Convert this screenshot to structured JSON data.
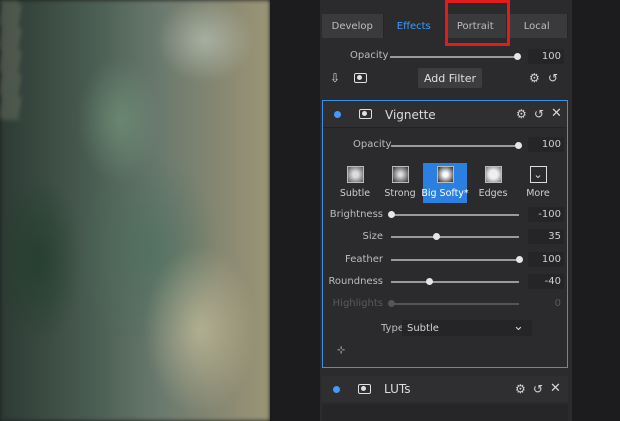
{
  "tabs": [
    {
      "label": "Develop",
      "active": false
    },
    {
      "label": "Effects",
      "active": true
    },
    {
      "label": "Portrait",
      "active": false
    },
    {
      "label": "Local",
      "active": false
    }
  ],
  "global": {
    "opacity_label": "Opacity",
    "opacity_value": "100",
    "opacity_fraction": 1.0,
    "add_filter_label": "Add Filter"
  },
  "vignette": {
    "title": "Vignette",
    "opacity_label": "Opacity",
    "opacity_value": "100",
    "opacity_fraction": 1.0,
    "presets": [
      {
        "label": "Subtle",
        "selected": false
      },
      {
        "label": "Strong",
        "selected": false
      },
      {
        "label": "Big Softy*",
        "selected": true
      },
      {
        "label": "Edges",
        "selected": false
      },
      {
        "label": "More",
        "selected": false
      }
    ],
    "sliders": [
      {
        "label": "Brightness",
        "value": "-100",
        "fraction": 0.0,
        "enabled": true
      },
      {
        "label": "Size",
        "value": "35",
        "fraction": 0.35,
        "enabled": true
      },
      {
        "label": "Feather",
        "value": "100",
        "fraction": 1.0,
        "enabled": true
      },
      {
        "label": "Roundness",
        "value": "-40",
        "fraction": 0.3,
        "enabled": true
      },
      {
        "label": "Highlights",
        "value": "0",
        "fraction": 0.0,
        "enabled": false
      }
    ],
    "type_label": "Type",
    "type_value": "Subtle"
  },
  "luts": {
    "title": "LUTs"
  },
  "colors": {
    "accent": "#3e9bff",
    "highlight_box": "#e21b1b",
    "panel": "#2b2b2d"
  }
}
